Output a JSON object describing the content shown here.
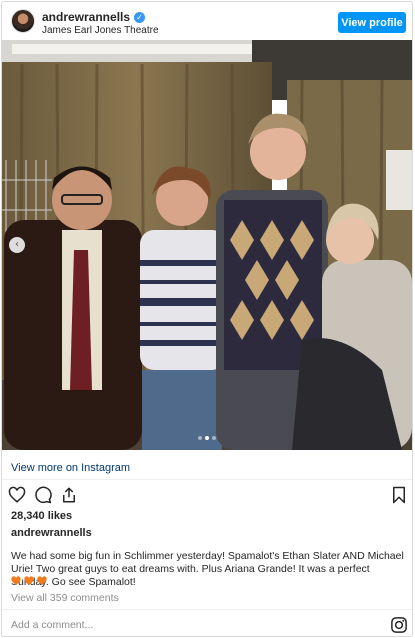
{
  "header": {
    "username": "andrewrannells",
    "verified_icon": "verified-badge-icon",
    "location": "James Earl Jones Theatre",
    "view_profile_label": "View profile"
  },
  "photo": {
    "carousel_dot_count": 3,
    "carousel_active_index": 1
  },
  "view_more_label": "View more on Instagram",
  "actions": {
    "icons": [
      "heart-icon",
      "comment-icon",
      "share-icon",
      "bookmark-icon"
    ]
  },
  "likes": "28,340 likes",
  "author": "andrewrannells",
  "caption": "We had some big fun in Schlimmer yesterday! Spamalot's Ethan Slater AND Michael Urie! Two great guys to eat dreams with. Plus Ariana Grande! It was a perfect Sunday. Go see Spamalot!",
  "caption_emoji_count": 3,
  "view_comments_label": "View all 359 comments",
  "add_comment_placeholder": "Add a comment...",
  "colors": {
    "accent": "#0095f6",
    "link": "#00376b",
    "muted": "#8e8e8e",
    "heart_emoji": "#f07c1e"
  }
}
